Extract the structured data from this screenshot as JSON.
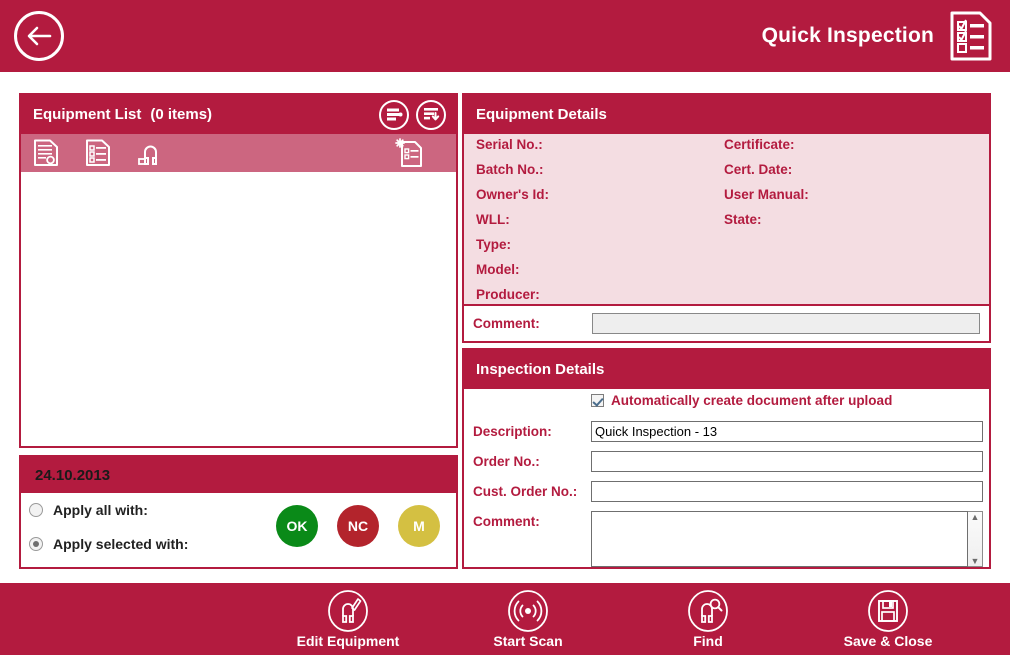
{
  "header": {
    "title": "Quick Inspection",
    "back_icon": "back-arrow-icon",
    "app_icon": "checklist-document-icon"
  },
  "equipment_list": {
    "title": "Equipment List",
    "count_text": "(0 items)",
    "header_buttons": [
      {
        "name": "filter-settings-button",
        "icon": "sliders-icon"
      },
      {
        "name": "sort-download-button",
        "icon": "list-download-icon"
      }
    ],
    "toolbar_icons": [
      {
        "name": "certificate-icon",
        "label": "Certificate"
      },
      {
        "name": "checklist-document-icon",
        "label": "Checklist"
      },
      {
        "name": "shackle-icon",
        "label": "Equipment"
      },
      {
        "name": "new-document-icon",
        "label": "New Document"
      }
    ],
    "rows": []
  },
  "apply_panel": {
    "date": "24.10.2013",
    "options": [
      {
        "label": "Apply all with:",
        "selected": false
      },
      {
        "label": "Apply selected with:",
        "selected": true
      }
    ],
    "status_buttons": [
      {
        "label": "OK",
        "color": "#0a8a18"
      },
      {
        "label": "NC",
        "color": "#b3242c"
      },
      {
        "label": "M",
        "color": "#d4c042"
      }
    ]
  },
  "equipment_details": {
    "title": "Equipment Details",
    "left_labels": [
      "Serial No.:",
      "Batch No.:",
      "Owner's Id:",
      "WLL:",
      "Type:",
      "Model:",
      "Producer:"
    ],
    "right_labels": [
      "Certificate:",
      "Cert. Date:",
      "User Manual:",
      "State:"
    ],
    "comment_label": "Comment:",
    "comment_value": ""
  },
  "inspection_details": {
    "title": "Inspection Details",
    "auto_create_label": "Automatically create document after upload",
    "auto_create_checked": true,
    "fields": [
      {
        "label": "Description:",
        "value": "Quick Inspection - 13",
        "placeholder": ""
      },
      {
        "label": "Order No.:",
        "value": "",
        "placeholder": ""
      },
      {
        "label": "Cust. Order No.:",
        "value": "",
        "placeholder": ""
      }
    ],
    "comment_label": "Comment:",
    "comment_value": ""
  },
  "bottom_toolbar": {
    "items": [
      {
        "label": "Edit Equipment",
        "icon": "shackle-edit-icon"
      },
      {
        "label": "Start Scan",
        "icon": "rfid-scan-icon"
      },
      {
        "label": "Find",
        "icon": "shackle-search-icon"
      },
      {
        "label": "Save & Close",
        "icon": "floppy-save-icon"
      }
    ]
  },
  "colors": {
    "brand": "#b31b3f",
    "subbar": "#cc6680",
    "details_bg": "#f4dde2",
    "ok": "#0a8a18",
    "nc": "#b3242c",
    "m": "#d4c042"
  }
}
